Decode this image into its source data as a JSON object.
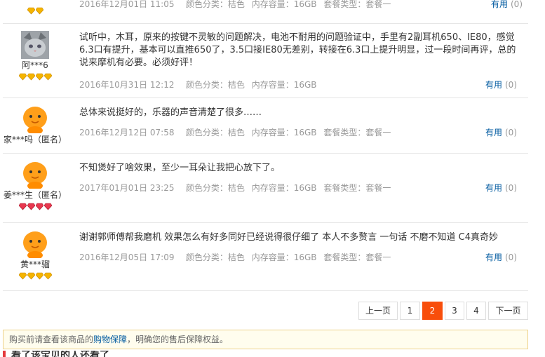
{
  "reviews": [
    {
      "user": "",
      "date": "2016年12月01日 11:05",
      "color_label": "颜色分类：",
      "color": "桔色",
      "storage_label": "内存容量：",
      "storage": "16GB",
      "plan_label": "套餐类型：",
      "plan": "套餐一",
      "text": "",
      "useful_label": "有用",
      "useful_count": "(0)"
    },
    {
      "user": "阿***6",
      "date": "2016年10月31日 12:12",
      "color_label": "颜色分类：",
      "color": "桔色",
      "storage_label": "内存容量：",
      "storage": "16GB",
      "text": "试听中，木耳，原来的按键不灵敏的问题解决，电池不耐用的问题验证中，手里有2副耳机650、IE80，感觉6.3口有提升，基本可以直推650了，3.5口接IE80无差别，转接在6.3口上提升明显，过一段时间再评，总的说来摩机有必要。必须好评！",
      "useful_label": "有用",
      "useful_count": "(0)"
    },
    {
      "user": "家***吗（匿名）",
      "date": "2016年12月12日 07:58",
      "color_label": "颜色分类：",
      "color": "桔色",
      "storage_label": "内存容量：",
      "storage": "16GB",
      "plan_label": "套餐类型：",
      "plan": "套餐一",
      "text": "总体来说挺好的，乐器的声音清楚了很多……",
      "useful_label": "有用",
      "useful_count": "(0)"
    },
    {
      "user": "姜***生（匿名）",
      "date": "2017年01月01日 23:25",
      "color_label": "颜色分类：",
      "color": "桔色",
      "storage_label": "内存容量：",
      "storage": "16GB",
      "plan_label": "套餐类型：",
      "plan": "套餐一",
      "text": "不知煲好了啥效果，至少一耳朵让我把心放下了。",
      "useful_label": "有用",
      "useful_count": "(0)"
    },
    {
      "user": "黄***骝",
      "date": "2016年12月05日 17:09",
      "color_label": "颜色分类：",
      "color": "桔色",
      "storage_label": "内存容量：",
      "storage": "16GB",
      "plan_label": "套餐类型：",
      "plan": "套餐一",
      "text": "谢谢郭师傅帮我磨机 效果怎么有好多同好已经说得很仔细了 本人不多赘言 一句话 不磨不知道 C4真奇妙",
      "useful_label": "有用",
      "useful_count": "(0)"
    }
  ],
  "pagination": {
    "prev": "上一页",
    "pages": [
      "1",
      "2",
      "3",
      "4"
    ],
    "current": "2",
    "next": "下一页"
  },
  "notice": {
    "prefix": "购买前请查看该商品的",
    "link": "购物保障",
    "suffix": "，明确您的售后保障权益。"
  },
  "section_title": "看了该宝贝的人还看了",
  "colors": {
    "accent": "#f84e0b",
    "link": "#005aa0"
  }
}
